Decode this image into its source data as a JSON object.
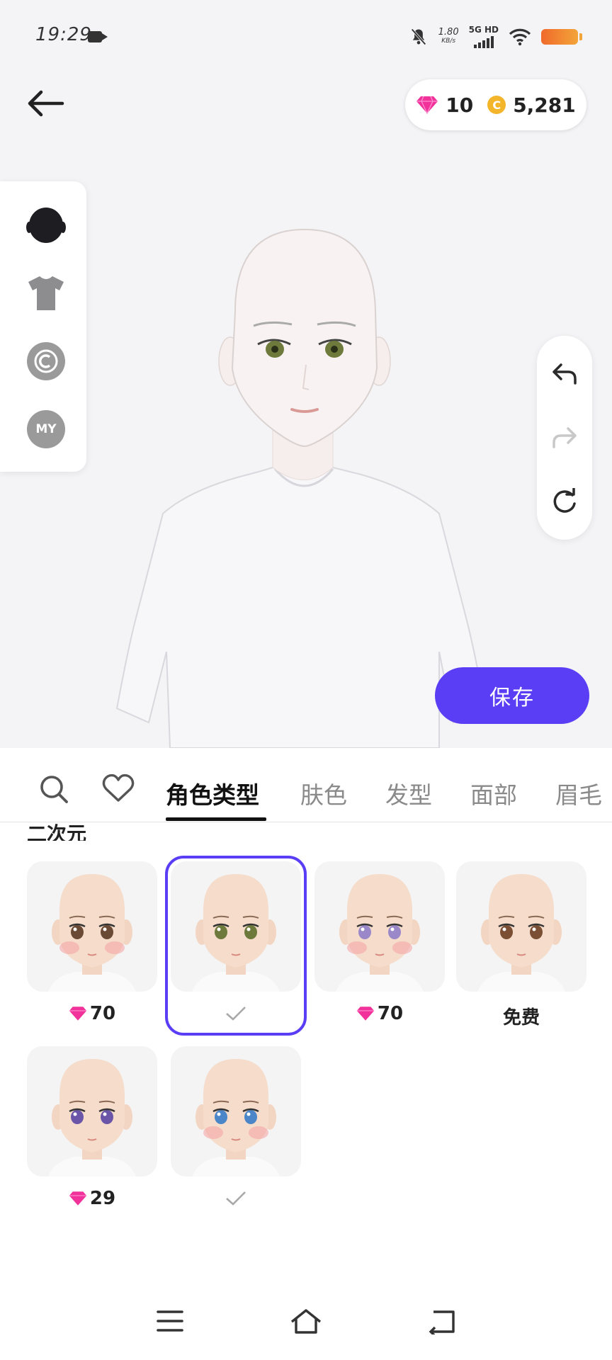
{
  "status": {
    "time": "19:29",
    "net_speed": "1.80",
    "net_unit": "KB/s",
    "network": "5G HD"
  },
  "header": {
    "diamonds": "10",
    "coins": "5,281",
    "coin_symbol": "C"
  },
  "left_panel": {
    "my_label": "MY"
  },
  "save_label": "保存",
  "tabs": [
    "角色类型",
    "肤色",
    "发型",
    "面部",
    "眉毛"
  ],
  "section_title": "二次元",
  "options": [
    {
      "price": "70",
      "selected": false,
      "eye": "#6b4a35",
      "blush": true
    },
    {
      "price": "",
      "selected": true,
      "eye": "#6d7a3c",
      "blush": false
    },
    {
      "price": "70",
      "selected": false,
      "eye": "#9a88c9",
      "blush": true
    },
    {
      "price": "免费",
      "selected": false,
      "eye": "#7a4f34",
      "blush": false
    },
    {
      "price": "29",
      "selected": false,
      "eye": "#6a55a8",
      "blush": false
    },
    {
      "price": "",
      "selected": false,
      "eye": "#4a86c8",
      "blush": true
    }
  ],
  "colors": {
    "accent": "#5a3ef5",
    "diamond": "#f0329a",
    "coin": "#f3b52a"
  }
}
